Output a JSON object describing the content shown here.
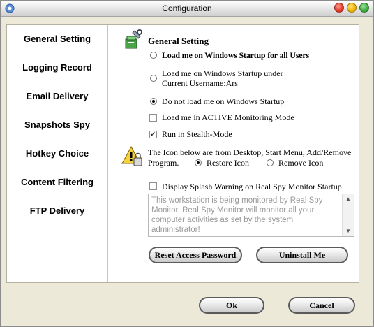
{
  "window": {
    "title": "Configuration"
  },
  "nav": {
    "items": [
      {
        "label": "General Setting"
      },
      {
        "label": "Logging Record"
      },
      {
        "label": "Email Delivery"
      },
      {
        "label": "Snapshots Spy"
      },
      {
        "label": "Hotkey Choice"
      },
      {
        "label": "Content Filtering"
      },
      {
        "label": "FTP Delivery"
      }
    ]
  },
  "general": {
    "heading": "General Setting",
    "startup": {
      "opt_all_users": "Load me on Windows Startup for all Users",
      "opt_current_user_line1": "Load me on Windows Startup under",
      "opt_current_user_line2": "Current Username:Ars",
      "opt_none": "Do not load me on Windows Startup",
      "selected": "none"
    },
    "active_mode": {
      "label": "Load me in ACTIVE Monitoring Mode",
      "checked": false
    },
    "stealth": {
      "label": "Run in Stealth-Mode",
      "checked": true
    },
    "icons": {
      "text_line1": "The Icon below are from Desktop, Start Menu, Add/Remove",
      "text_line2": "Program.",
      "restore_label": "Restore Icon",
      "remove_label": "Remove Icon",
      "selected": "restore"
    },
    "splash": {
      "label": "Display Splash Warning on Real Spy Monitor Startup",
      "checked": false,
      "message": "This workstation is being monitored by Real Spy Monitor. Real Spy Monitor will monitor all your computer activities as set by the system administrator!"
    },
    "reset_button": "Reset Access Password",
    "uninstall_button": "Uninstall Me"
  },
  "footer": {
    "ok": "Ok",
    "cancel": "Cancel"
  },
  "colors": {
    "title_close": "#e0392b",
    "title_min": "#f0b400",
    "title_max": "#3cab3c"
  }
}
